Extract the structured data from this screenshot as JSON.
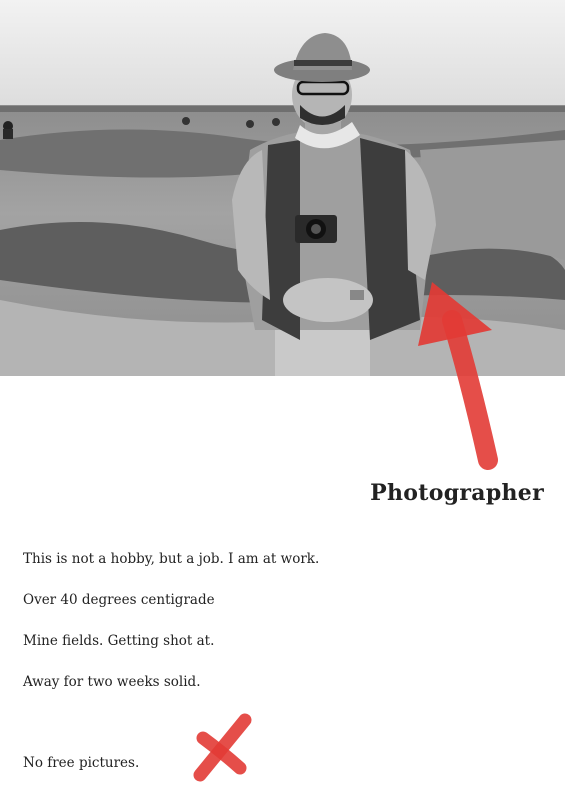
{
  "caption": {
    "title": "Photographer"
  },
  "lines": [
    "This is not a hobby, but a job. I am at work.",
    "Over 40 degrees centigrade",
    "Mine fields. Getting shot at.",
    "Away for two weeks solid.",
    "No free pictures."
  ],
  "colors": {
    "annotation": "#e23b35",
    "text": "#222222",
    "background": "#ffffff"
  },
  "icons": {
    "arrow": "red-arrow-icon",
    "cross": "red-x-icon"
  }
}
